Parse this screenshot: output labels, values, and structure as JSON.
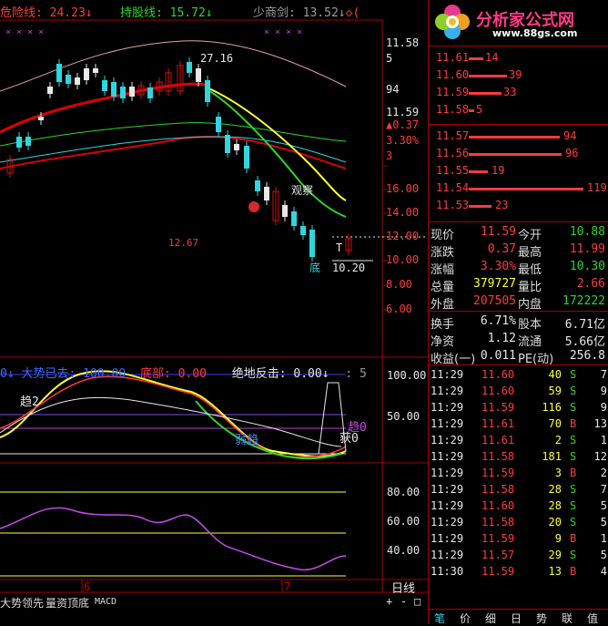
{
  "header": {
    "danger_label": "危险线: ",
    "danger_value": "24.23↓",
    "hold_label": "持股线: ",
    "hold_value": "15.72↓",
    "sword_label": "少商剑: ",
    "sword_value": "13.52↓",
    "marks": "◇(",
    "x_marks": "× × × ×",
    "x_marks2": "×   ×   ×   ×"
  },
  "price_axis": {
    "labels": [
      "11.58",
      "5",
      "94",
      "11.59",
      "▲0.37",
      "3.30%",
      "3",
      "16.00",
      "14.00",
      "12.00",
      "10.00",
      "8.00",
      "6.00"
    ]
  },
  "annotations": {
    "high": "27.16",
    "low": "10.20",
    "mid_value": "12.67",
    "observe": "观察",
    "buy_marker": "底",
    "t_marker": "T"
  },
  "indicator": {
    "header_arrow": "0↓",
    "trend_label": "大势已去: ",
    "trend_value": "100.00",
    "bottom_label": "底部: ",
    "bottom_value": "0.00",
    "rebound_label": "绝地反击: ",
    "rebound_value": "0.00↓",
    "right_mark": ": 5",
    "axis": [
      "100.00",
      "50.00"
    ],
    "trend2": "趋2",
    "trend_label2": "弱趋",
    "trend0": "趋0",
    "gain0": "获0"
  },
  "oscillator": {
    "axis": [
      "80.00",
      "60.00",
      "40.00"
    ]
  },
  "xaxis": {
    "ticks": [
      "6",
      "7"
    ],
    "period": "日线"
  },
  "tabs": [
    "大势领先",
    "量资顶底",
    "MACD"
  ],
  "nav_buttons": [
    "+",
    "-",
    "□"
  ],
  "logo": {
    "title": "分析家公式网",
    "url": "www.88gs.com"
  },
  "order_book": {
    "asks": [
      {
        "price": "11.61",
        "vol": "14",
        "w": 16
      },
      {
        "price": "11.60",
        "vol": "39",
        "w": 42
      },
      {
        "price": "11.59",
        "vol": "33",
        "w": 36
      },
      {
        "price": "11.58",
        "vol": "5",
        "w": 6
      }
    ],
    "bids": [
      {
        "price": "11.57",
        "vol": "94",
        "w": 100
      },
      {
        "price": "11.56",
        "vol": "96",
        "w": 102
      },
      {
        "price": "11.55",
        "vol": "19",
        "w": 21
      },
      {
        "price": "11.54",
        "vol": "119",
        "w": 126
      },
      {
        "price": "11.53",
        "vol": "23",
        "w": 25
      }
    ]
  },
  "quote": [
    {
      "l1": "现价",
      "v1": "11.59",
      "c1": "red",
      "l2": "今开",
      "v2": "10.88",
      "c2": "green"
    },
    {
      "l1": "涨跌",
      "v1": "0.37",
      "c1": "red",
      "l2": "最高",
      "v2": "11.99",
      "c2": "red"
    },
    {
      "l1": "涨幅",
      "v1": "3.30%",
      "c1": "red",
      "l2": "最低",
      "v2": "10.30",
      "c2": "green"
    },
    {
      "l1": "总量",
      "v1": "379727",
      "c1": "yellow",
      "l2": "量比",
      "v2": "2.66",
      "c2": "red"
    },
    {
      "l1": "外盘",
      "v1": "207505",
      "c1": "red",
      "l2": "内盘",
      "v2": "172222",
      "c2": "green"
    }
  ],
  "stats": [
    {
      "l1": "换手",
      "v1": "6.71%",
      "l2": "股本",
      "v2": "6.71亿"
    },
    {
      "l1": "净资",
      "v1": "1.12",
      "l2": "流通",
      "v2": "5.66亿"
    },
    {
      "l1": "收益(一)",
      "v1": "0.011",
      "l2": "PE(动)",
      "v2": "256.8"
    }
  ],
  "ticks": [
    {
      "t": "11:29",
      "p": "11.60",
      "pc": "red",
      "v": "40",
      "s": "S",
      "sc": "green",
      "n": "7"
    },
    {
      "t": "11:29",
      "p": "11.60",
      "pc": "red",
      "v": "59",
      "s": "S",
      "sc": "green",
      "n": "9"
    },
    {
      "t": "11:29",
      "p": "11.59",
      "pc": "red",
      "v": "116",
      "s": "S",
      "sc": "green",
      "n": "9"
    },
    {
      "t": "11:29",
      "p": "11.61",
      "pc": "red",
      "v": "70",
      "s": "B",
      "sc": "red",
      "n": "13"
    },
    {
      "t": "11:29",
      "p": "11.61",
      "pc": "red",
      "v": "2",
      "s": "S",
      "sc": "green",
      "n": "1"
    },
    {
      "t": "11:29",
      "p": "11.58",
      "pc": "red",
      "v": "181",
      "s": "S",
      "sc": "green",
      "n": "12"
    },
    {
      "t": "11:29",
      "p": "11.59",
      "pc": "red",
      "v": "3",
      "s": "B",
      "sc": "red",
      "n": "2"
    },
    {
      "t": "11:29",
      "p": "11.58",
      "pc": "red",
      "v": "28",
      "s": "S",
      "sc": "green",
      "n": "7"
    },
    {
      "t": "11:29",
      "p": "11.60",
      "pc": "red",
      "v": "28",
      "s": "S",
      "sc": "green",
      "n": "5"
    },
    {
      "t": "11:29",
      "p": "11.58",
      "pc": "red",
      "v": "20",
      "s": "S",
      "sc": "green",
      "n": "5"
    },
    {
      "t": "11:29",
      "p": "11.59",
      "pc": "red",
      "v": "9",
      "s": "B",
      "sc": "red",
      "n": "1"
    },
    {
      "t": "11:29",
      "p": "11.57",
      "pc": "red",
      "v": "29",
      "s": "S",
      "sc": "green",
      "n": "5"
    },
    {
      "t": "11:30",
      "p": "11.59",
      "pc": "red",
      "v": "13",
      "s": "B",
      "sc": "red",
      "n": "4"
    }
  ],
  "bottom_tabs": [
    "笔",
    "价",
    "细",
    "日",
    "势",
    "联",
    "值"
  ]
}
